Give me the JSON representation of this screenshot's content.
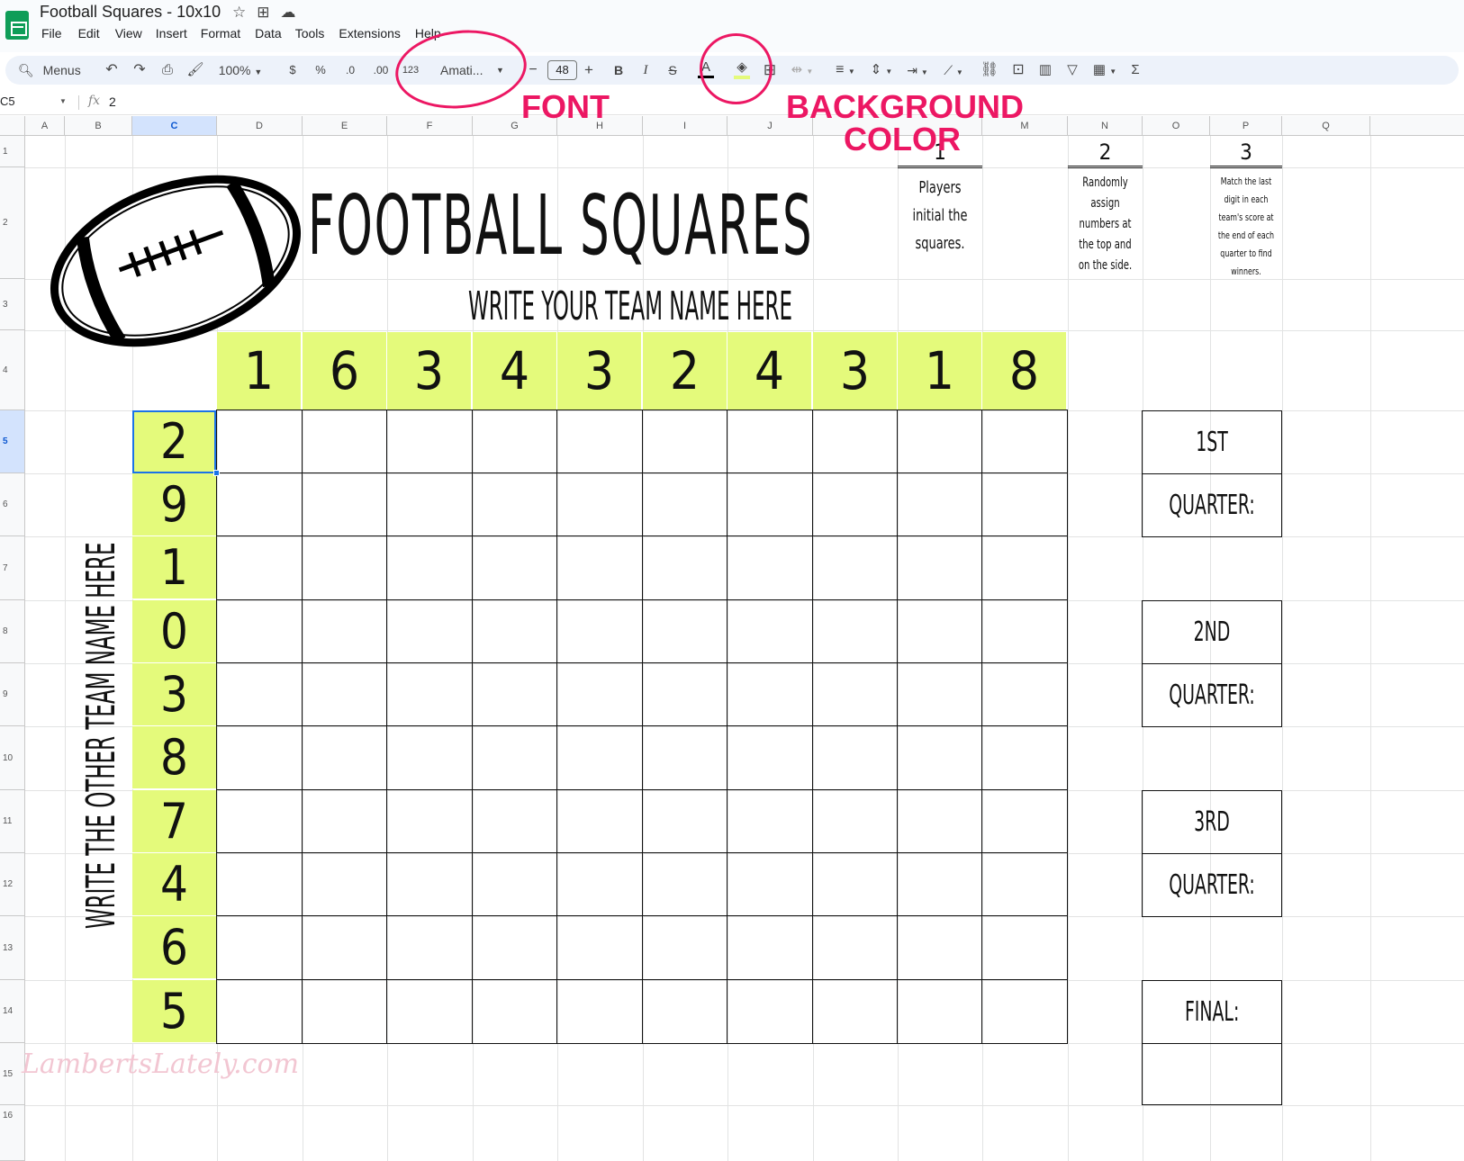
{
  "app": {
    "title": "Football Squares - 10x10",
    "menu": [
      "File",
      "Edit",
      "View",
      "Insert",
      "Format",
      "Data",
      "Tools",
      "Extensions",
      "Help"
    ]
  },
  "toolbar": {
    "menus_label": "Menus",
    "zoom": "100%",
    "currency": "$",
    "percent": "%",
    "dec_decrease": ".0",
    "dec_increase": ".00",
    "number_format": "123",
    "font": "Amati...",
    "font_size": "48",
    "minus": "−",
    "plus": "+",
    "bold": "B",
    "italic": "I",
    "strike": "S",
    "text_color": "A",
    "fill_color": "#e4fa7b",
    "sum": "Σ"
  },
  "formula_bar": {
    "cell_ref": "C5",
    "fx": "fx",
    "value": "2"
  },
  "columns": [
    "A",
    "B",
    "C",
    "D",
    "E",
    "F",
    "G",
    "H",
    "I",
    "J",
    "",
    "M",
    "N",
    "O",
    "P",
    "Q"
  ],
  "rows": [
    "1",
    "2",
    "3",
    "4",
    "5",
    "6",
    "7",
    "8",
    "9",
    "10",
    "11",
    "12",
    "13",
    "14",
    "15",
    "16"
  ],
  "sheet": {
    "title": "Football Squares",
    "top_team": "Write your team name here",
    "side_team": "Write the other team name here",
    "top_numbers": [
      "1",
      "6",
      "3",
      "4",
      "3",
      "2",
      "4",
      "3",
      "1",
      "8"
    ],
    "side_numbers": [
      "2",
      "9",
      "1",
      "0",
      "3",
      "8",
      "7",
      "4",
      "6",
      "5"
    ],
    "steps": [
      {
        "num": "1",
        "text": "Players initial the squares."
      },
      {
        "num": "2",
        "text": "Randomly assign numbers at the top and on the side."
      },
      {
        "num": "3",
        "text": "Match the last digit in each team's score at the end of each quarter to find winners."
      }
    ],
    "quarters": [
      "1st Quarter:",
      "2nd Quarter:",
      "3rd Quarter:",
      "Final:"
    ],
    "highlight_color": "#e4fa7b"
  },
  "annotations": {
    "font": "FONT",
    "background": "BACKGROUND",
    "color": "COLOR",
    "color_hex": "#ec1763"
  },
  "watermark": "LambertsLately.com"
}
